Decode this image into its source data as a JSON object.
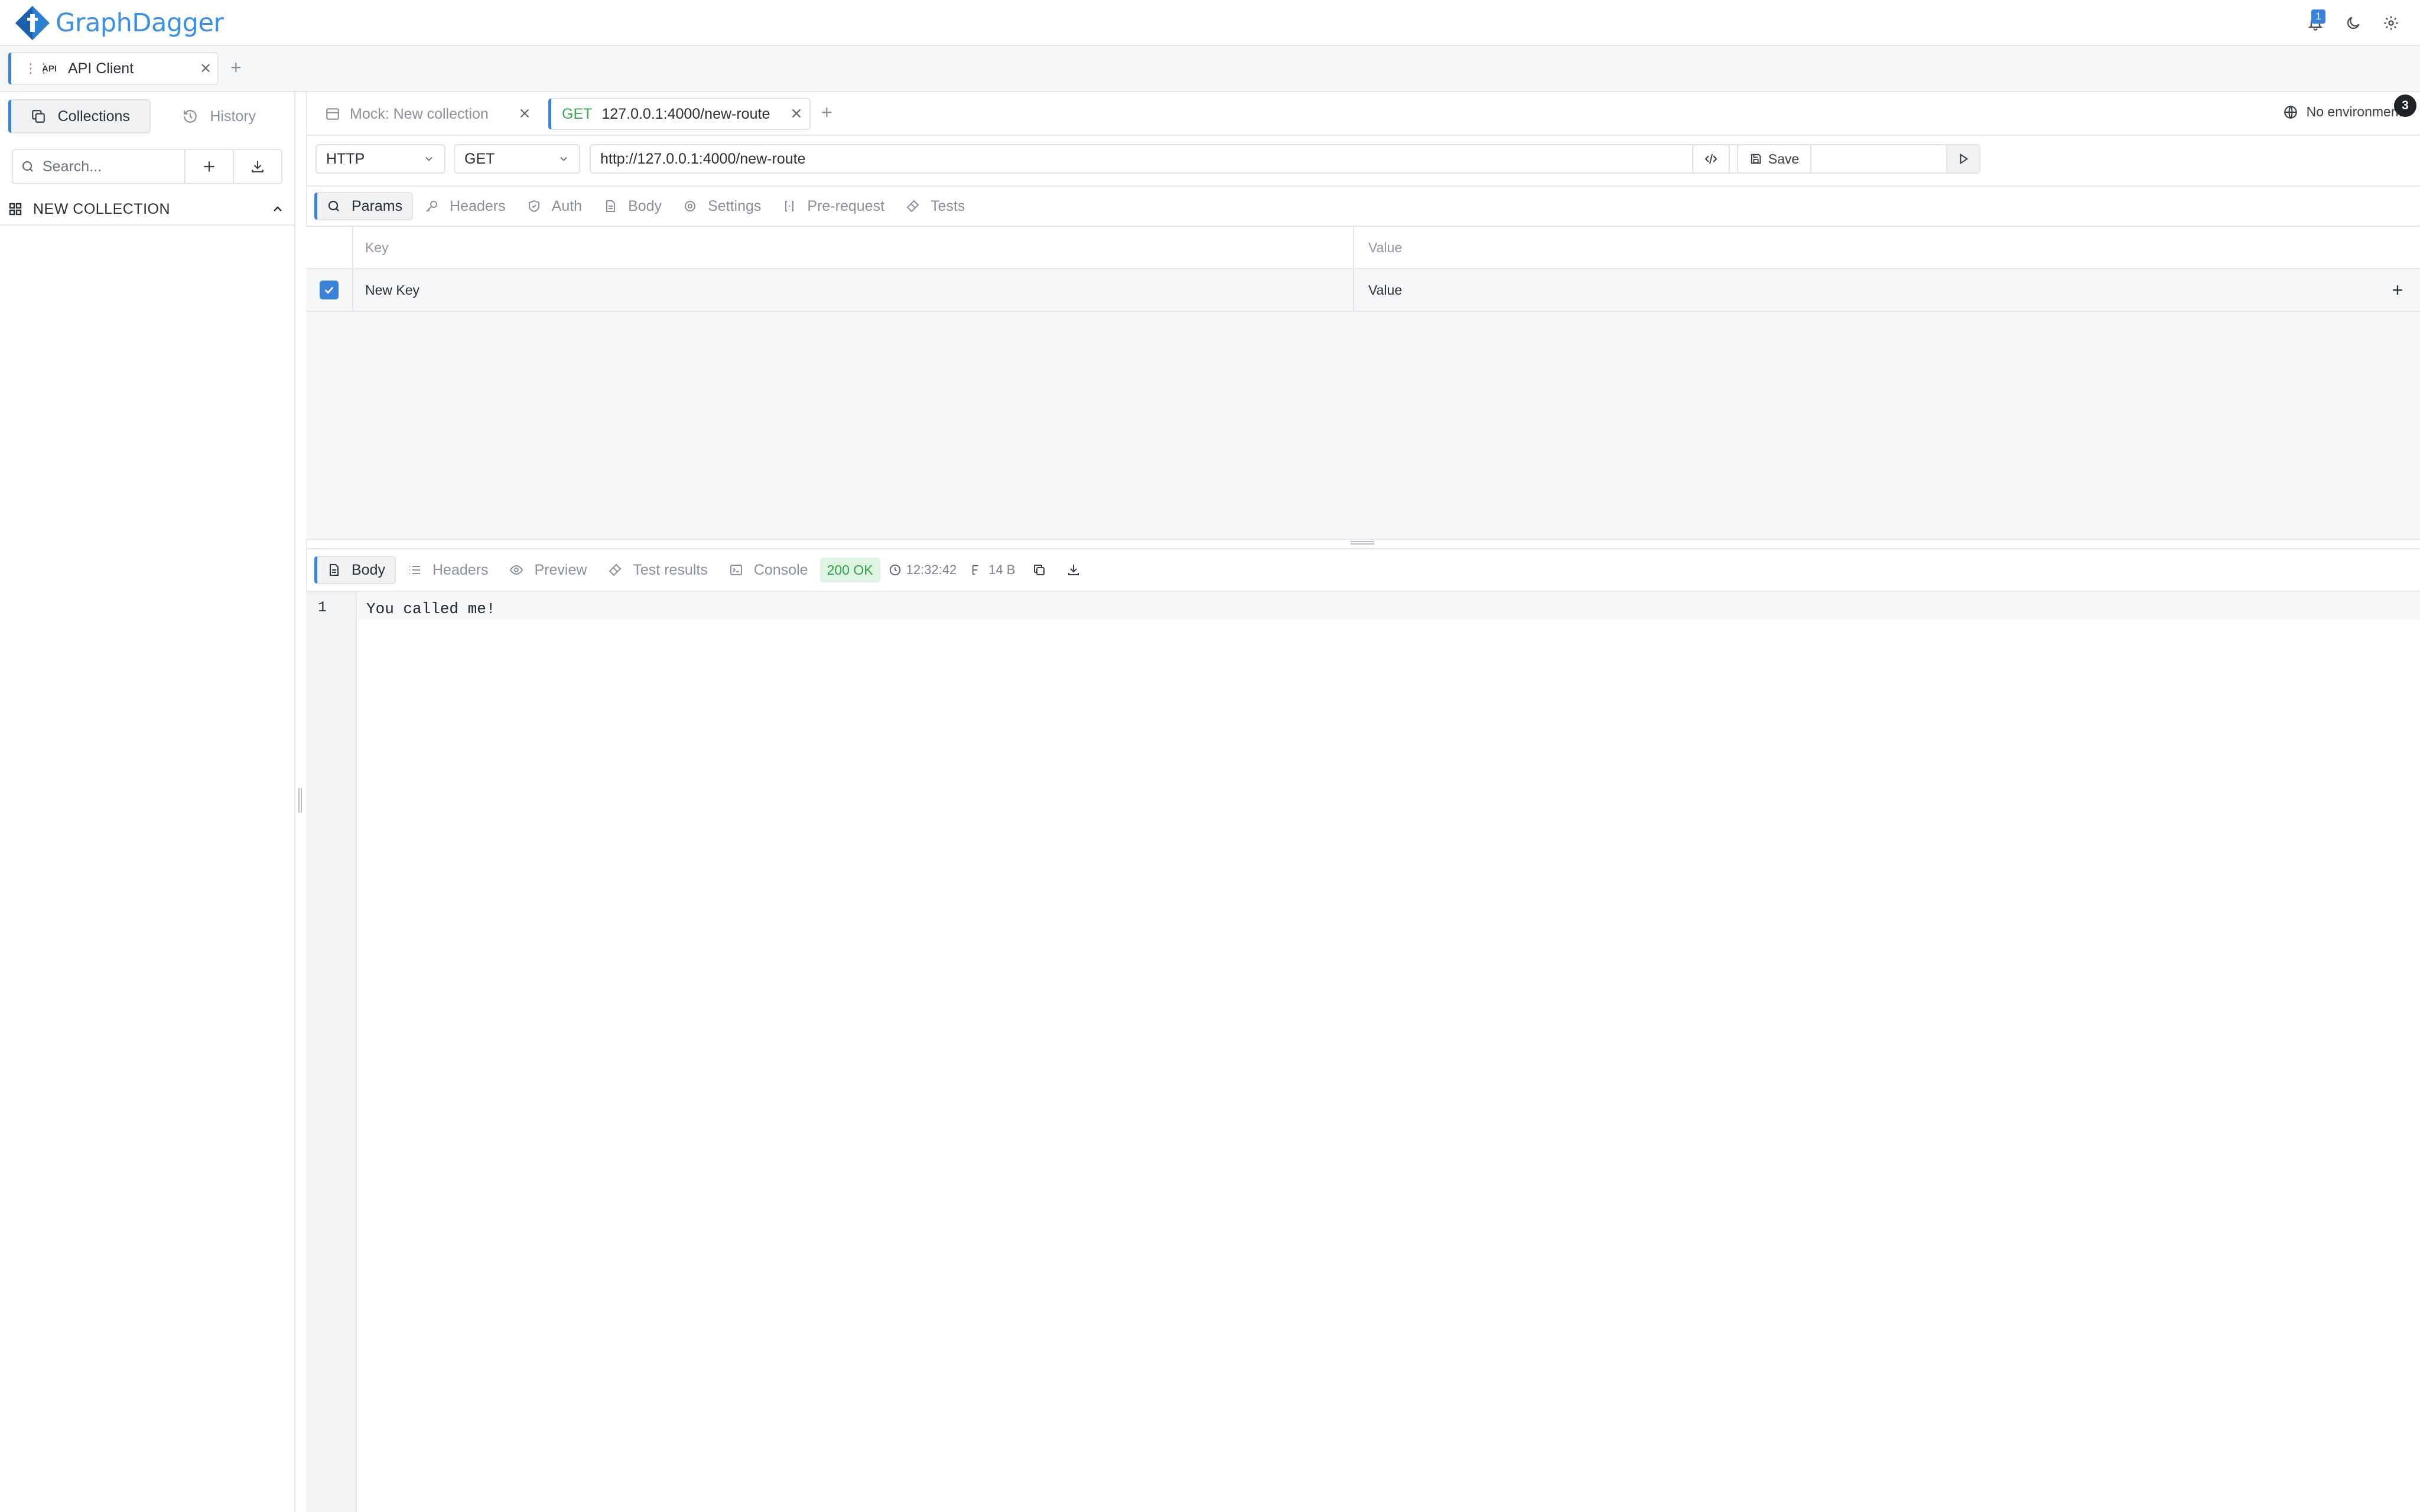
{
  "app": {
    "name": "GraphDagger",
    "notification_count": "1"
  },
  "app_tab": {
    "label": "API Client",
    "badge": "API"
  },
  "sidebar": {
    "segments": [
      {
        "label": "Collections"
      },
      {
        "label": "History"
      }
    ],
    "search": {
      "placeholder": "Search..."
    },
    "collection": {
      "label": "NEW COLLECTION"
    }
  },
  "request_tabs": [
    {
      "label": "Mock: New collection"
    },
    {
      "method": "GET",
      "label": "127.0.0.1:4000/new-route"
    }
  ],
  "environment": {
    "label": "No environment",
    "count": "3"
  },
  "request": {
    "protocol": "HTTP",
    "method": "GET",
    "url": "http://127.0.0.1:4000/new-route",
    "save_label": "Save"
  },
  "request_subtabs": [
    {
      "label": "Params",
      "icon": "search-icon"
    },
    {
      "label": "Headers",
      "icon": "key-icon"
    },
    {
      "label": "Auth",
      "icon": "shield-icon"
    },
    {
      "label": "Body",
      "icon": "file-icon"
    },
    {
      "label": "Settings",
      "icon": "gear-icon"
    },
    {
      "label": "Pre-request",
      "icon": "braces-icon"
    },
    {
      "label": "Tests",
      "icon": "flask-icon"
    }
  ],
  "params": {
    "headers": {
      "key": "Key",
      "value": "Value"
    },
    "rows": [
      {
        "key": "New Key",
        "value": "Value",
        "checked": true
      }
    ]
  },
  "response_tabs": [
    {
      "label": "Body",
      "icon": "file-icon"
    },
    {
      "label": "Headers",
      "icon": "list-icon"
    },
    {
      "label": "Preview",
      "icon": "eye-icon"
    },
    {
      "label": "Test results",
      "icon": "flask-icon"
    },
    {
      "label": "Console",
      "icon": "terminal-icon"
    }
  ],
  "response": {
    "status": "200 OK",
    "time": "12:32:42",
    "size": "14 B",
    "lines": [
      {
        "number": "1",
        "text": "You called me!"
      }
    ]
  },
  "colors": {
    "accent": "#3b82d8",
    "brand": "#3d8fe0",
    "success": "#35a853"
  }
}
